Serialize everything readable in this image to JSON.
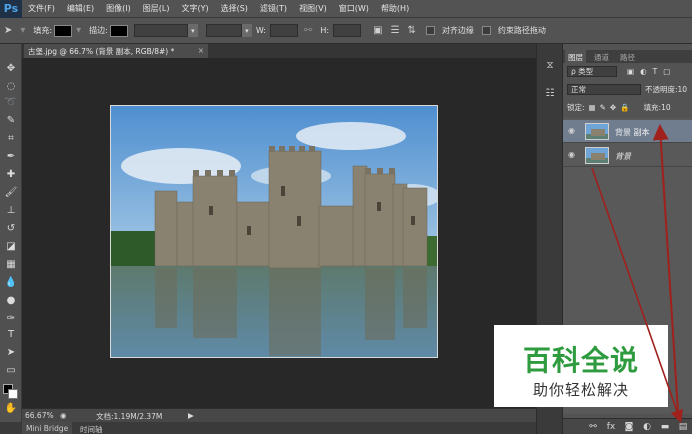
{
  "app": {
    "logo": "Ps"
  },
  "menu": [
    "文件(F)",
    "编辑(E)",
    "图像(I)",
    "图层(L)",
    "文字(Y)",
    "选择(S)",
    "滤镜(T)",
    "视图(V)",
    "窗口(W)",
    "帮助(H)"
  ],
  "options": {
    "fill_label": "填充:",
    "stroke_label": "描边:",
    "w_label": "W:",
    "h_label": "H:",
    "align_edges": "对齐边缘",
    "constrain_path": "约束路径拖动"
  },
  "document": {
    "tab_title": "古堡.jpg @ 66.7% (背景 副本, RGB/8#) *",
    "close": "×"
  },
  "status": {
    "zoom": "66.67%",
    "doc_info": "文档:1.19M/2.37M"
  },
  "bottom_tabs": [
    "Mini Bridge",
    "时间轴"
  ],
  "panel": {
    "tabs": [
      "图层",
      "通道",
      "路径"
    ],
    "filter_kind": "ρ 类型",
    "blend_mode": "正常",
    "opacity_label": "不透明度:",
    "opacity_value": "10",
    "lock_label": "锁定:",
    "fill_label": "填充:",
    "fill_value": "10"
  },
  "layers": [
    {
      "name": "背景 副本",
      "selected": true,
      "italic": false
    },
    {
      "name": "背景",
      "selected": false,
      "italic": true
    }
  ],
  "watermark": {
    "title": "百科全说",
    "subtitle": "助你轻松解决"
  },
  "colors": {
    "arrow": "#a0201c",
    "menubar": "#535353",
    "selected_layer": "#6f7d8f"
  }
}
